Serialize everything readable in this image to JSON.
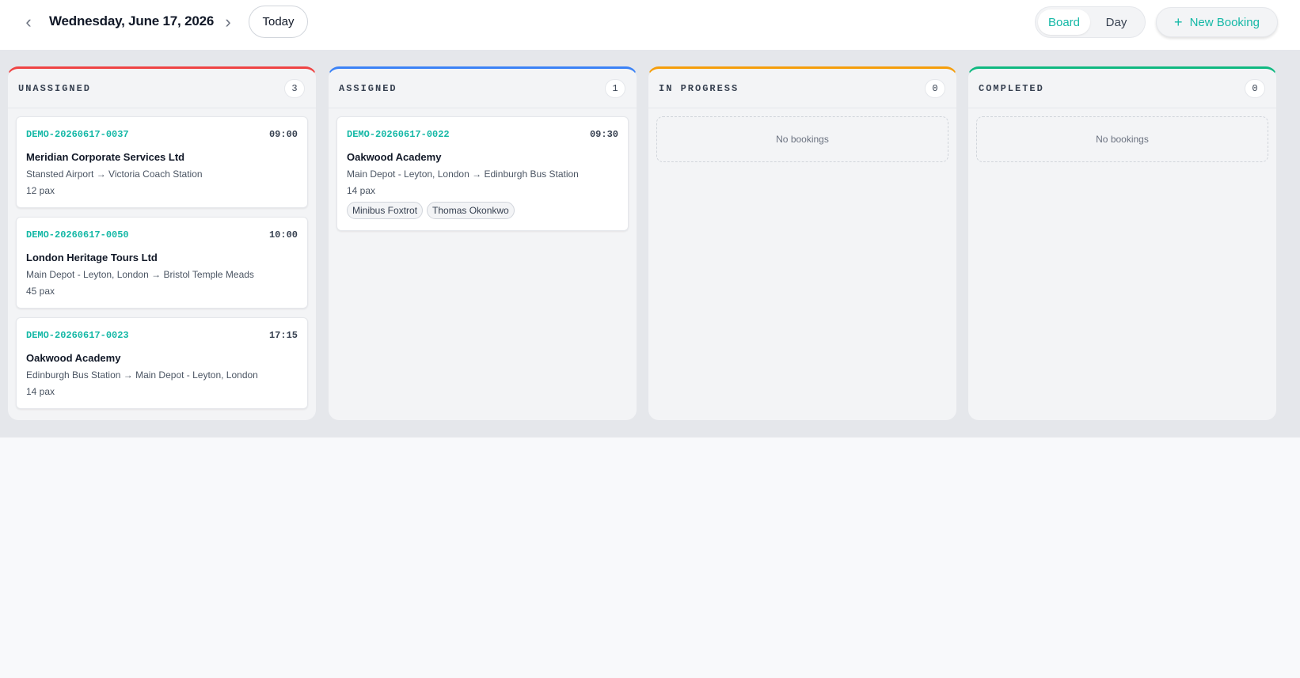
{
  "header": {
    "date_title": "Wednesday, June 17, 2026",
    "prev_icon": "chevron-left-icon",
    "next_icon": "chevron-right-icon",
    "today_label": "Today",
    "view_options": [
      {
        "label": "Board",
        "active": true
      },
      {
        "label": "Day",
        "active": false
      }
    ],
    "new_booking_label": "New Booking",
    "new_booking_icon": "plus-icon"
  },
  "colors": {
    "accent": "#14b8a6",
    "unassigned": "#ef4444",
    "assigned": "#3b82f6",
    "in_progress": "#f59e0b",
    "completed": "#10b981"
  },
  "columns": [
    {
      "key": "unassigned",
      "title": "UNASSIGNED",
      "count": "3",
      "cards": [
        {
          "ref": "DEMO-20260617-0037",
          "time": "09:00",
          "client": "Meridian Corporate Services Ltd",
          "route": "Stansted Airport → Victoria Coach Station",
          "pax": "12 pax",
          "chips": []
        },
        {
          "ref": "DEMO-20260617-0050",
          "time": "10:00",
          "client": "London Heritage Tours Ltd",
          "route": "Main Depot - Leyton, London → Bristol Temple Meads",
          "pax": "45 pax",
          "chips": []
        },
        {
          "ref": "DEMO-20260617-0023",
          "time": "17:15",
          "client": "Oakwood Academy",
          "route": "Edinburgh Bus Station → Main Depot - Leyton, London",
          "pax": "14 pax",
          "chips": []
        }
      ],
      "empty_text": ""
    },
    {
      "key": "assigned",
      "title": "ASSIGNED",
      "count": "1",
      "cards": [
        {
          "ref": "DEMO-20260617-0022",
          "time": "09:30",
          "client": "Oakwood Academy",
          "route": "Main Depot - Leyton, London → Edinburgh Bus Station",
          "pax": "14 pax",
          "chips": [
            "Minibus Foxtrot",
            "Thomas Okonkwo"
          ]
        }
      ],
      "empty_text": ""
    },
    {
      "key": "in_progress",
      "title": "IN PROGRESS",
      "count": "0",
      "cards": [],
      "empty_text": "No bookings"
    },
    {
      "key": "completed",
      "title": "COMPLETED",
      "count": "0",
      "cards": [],
      "empty_text": "No bookings"
    }
  ]
}
